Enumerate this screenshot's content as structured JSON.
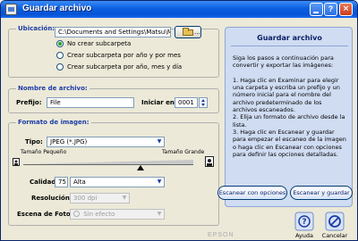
{
  "window": {
    "title": "Guardar archivo",
    "help_glyph": "?",
    "close_glyph": "×"
  },
  "ubicacion": {
    "label": "Ubicación:",
    "path": "C:\\Documents and Settings\\Matsu\\Mis",
    "browse_dots": "...",
    "options": [
      {
        "label": "No crear subcarpeta",
        "checked": true
      },
      {
        "label": "Crear subcarpeta por año y por mes",
        "checked": false
      },
      {
        "label": "Crear subcarpeta por año, mes y día",
        "checked": false
      }
    ]
  },
  "nombre": {
    "label": "Nombre de archivo:",
    "prefix_label": "Prefijo:",
    "prefix_value": "File",
    "start_label": "Iniciar en:",
    "start_value": "0001"
  },
  "formato": {
    "label": "Formato de imagen:",
    "tipo_label": "Tipo:",
    "tipo_value": "JPEG (*.JPG)",
    "size_small": "Tamaño Pequeño",
    "size_large": "Tamaño Grande",
    "slider_level": 0.69,
    "calidad_label": "Calidad:",
    "calidad_value": "75",
    "calidad_select": "Alta",
    "resolucion_label": "Resolución:",
    "resolucion_value": "300 dpi",
    "escena_label": "Escena de Foto:",
    "escena_value": "Sin efecto"
  },
  "help_panel": {
    "title": "Guardar archivo",
    "text": "Siga los pasos a continuación para convertir y exportar las imágenes:\n\n1. Haga clic en Examinar para elegir una carpeta y escriba un prefijo y un número inicial para el nombre del archivo predeterminado de los archivos escaneados.\n2. Elija un formato de archivo desde la lista.\n3. Haga clic en Escanear y guardar para empezar el escaneo de la imagen o haga clic en Escanear con opciones para definir las opciones detalladas."
  },
  "buttons": {
    "scan_options": "Escanear con opciones",
    "scan_save": "Escanear y guardar",
    "help": "Ayuda",
    "cancel": "Cancelar"
  },
  "brand": "EPSON",
  "colors": {
    "accent": "#1c3ca8",
    "panel": "#cfdcf2",
    "titlebar": "#0a5fe0"
  }
}
